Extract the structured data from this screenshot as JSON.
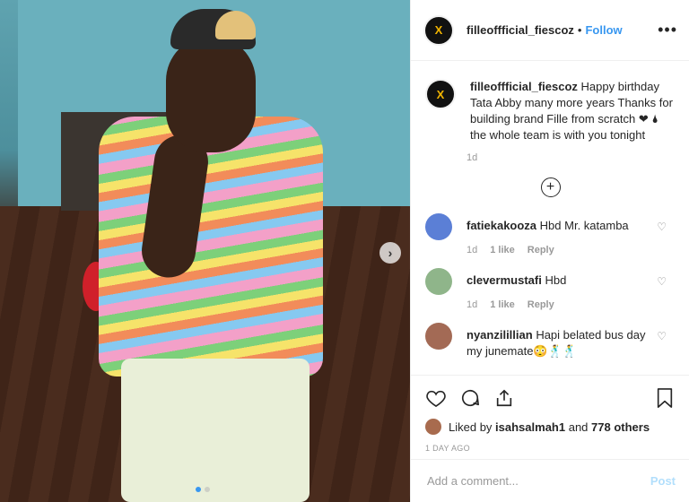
{
  "post": {
    "username": "filleoffficial_fiescoz",
    "separator": "•",
    "follow_label": "Follow",
    "more_label": "•••",
    "avatar_glyph": "X",
    "caption_username": "filleoffficial_fiescoz",
    "caption_text": "Happy birthday Tata Abby many more years Thanks for building brand Fille from scratch ❤ 🌢 the whole team is with you tonight",
    "caption_time": "1d",
    "load_more_glyph": "+",
    "next_glyph": "›"
  },
  "comments": [
    {
      "username": "fatiekakooza",
      "text": "Hbd Mr. katamba",
      "time": "1d",
      "likes": "1 like",
      "reply": "Reply",
      "avatar_color": "#5b7fd6"
    },
    {
      "username": "clevermustafi",
      "text": "Hbd",
      "time": "1d",
      "likes": "1 like",
      "reply": "Reply",
      "avatar_color": "#8fb58a"
    },
    {
      "username": "nyanzilillian",
      "text": "Hapi belated bus day my junemate😳🕺🕺",
      "time": "",
      "likes": "",
      "reply": "",
      "avatar_color": "#a36a55"
    }
  ],
  "footer": {
    "liked_by_prefix": "Liked by ",
    "liked_by_user": "isahsalmah1",
    "liked_by_mid": " and ",
    "liked_by_count": "778 others",
    "timestamp": "1 DAY AGO",
    "comment_placeholder": "Add a comment...",
    "post_label": "Post"
  },
  "icons": [
    "heart-icon",
    "comment-icon",
    "share-icon",
    "bookmark-icon"
  ],
  "colors": {
    "accent": "#3897f0",
    "post_disabled": "#b2dffc"
  }
}
